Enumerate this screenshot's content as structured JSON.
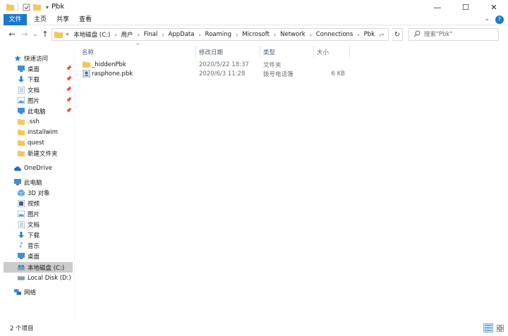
{
  "window": {
    "title": "Pbk",
    "minimize": "—",
    "maximize": "☐",
    "close": "✕"
  },
  "ribbon": {
    "tabs": [
      "文件",
      "主页",
      "共享",
      "查看"
    ],
    "collapse_glyph": "⌄",
    "help_glyph": "?"
  },
  "nav": {
    "back": "←",
    "forward": "→",
    "recent": "⌄",
    "up": "↑"
  },
  "address": {
    "overflow": "«",
    "crumbs": [
      "本地磁盘 (C:)",
      "用户",
      "Final",
      "AppData",
      "Roaming",
      "Microsoft",
      "Network",
      "Connections",
      "Pbk"
    ],
    "dropdown_glyph": "⌄"
  },
  "refresh_glyph": "↻",
  "search": {
    "placeholder": "搜索\"Pbk\"",
    "icon": "search-icon"
  },
  "sidebar": {
    "quick_access": {
      "label": "快速访问",
      "items": [
        {
          "label": "桌面",
          "icon": "desktop-icon",
          "pinned": true
        },
        {
          "label": "下载",
          "icon": "download-icon",
          "pinned": true
        },
        {
          "label": "文档",
          "icon": "documents-icon",
          "pinned": true
        },
        {
          "label": "图片",
          "icon": "pictures-icon",
          "pinned": true
        },
        {
          "label": "此电脑",
          "icon": "computer-icon",
          "pinned": true
        },
        {
          "label": ".ssh",
          "icon": "folder-icon",
          "pinned": false
        },
        {
          "label": "installwim",
          "icon": "folder-icon",
          "pinned": false
        },
        {
          "label": "quest",
          "icon": "folder-icon",
          "pinned": false
        },
        {
          "label": "新建文件夹",
          "icon": "folder-icon",
          "pinned": false
        }
      ]
    },
    "onedrive": {
      "label": "OneDrive"
    },
    "this_pc": {
      "label": "此电脑",
      "items": [
        {
          "label": "3D 对象",
          "icon": "3d-objects-icon"
        },
        {
          "label": "视频",
          "icon": "videos-icon"
        },
        {
          "label": "图片",
          "icon": "pictures-icon"
        },
        {
          "label": "文档",
          "icon": "documents-icon"
        },
        {
          "label": "下载",
          "icon": "download-icon"
        },
        {
          "label": "音乐",
          "icon": "music-icon"
        },
        {
          "label": "桌面",
          "icon": "desktop-icon"
        },
        {
          "label": "本地磁盘 (C:)",
          "icon": "drive-c-icon",
          "selected": true
        },
        {
          "label": "Local Disk (D:)",
          "icon": "drive-icon"
        }
      ]
    },
    "network": {
      "label": "网络"
    }
  },
  "columns": {
    "name": "名称",
    "date": "修改日期",
    "type": "类型",
    "size": "大小",
    "sort_glyph": "^"
  },
  "files": [
    {
      "name": "_hiddenPbk",
      "date": "2020/5/22 18:37",
      "type": "文件夹",
      "size": "",
      "icon": "folder-icon"
    },
    {
      "name": "rasphone.pbk",
      "date": "2020/6/3 11:28",
      "type": "拨号电话簿",
      "size": "6 KB",
      "icon": "phonebook-icon"
    }
  ],
  "status": {
    "count": "2 个项目"
  },
  "colors": {
    "accent": "#1979ca",
    "folder": "#f3c75b",
    "selected_bg": "#cccccc"
  }
}
